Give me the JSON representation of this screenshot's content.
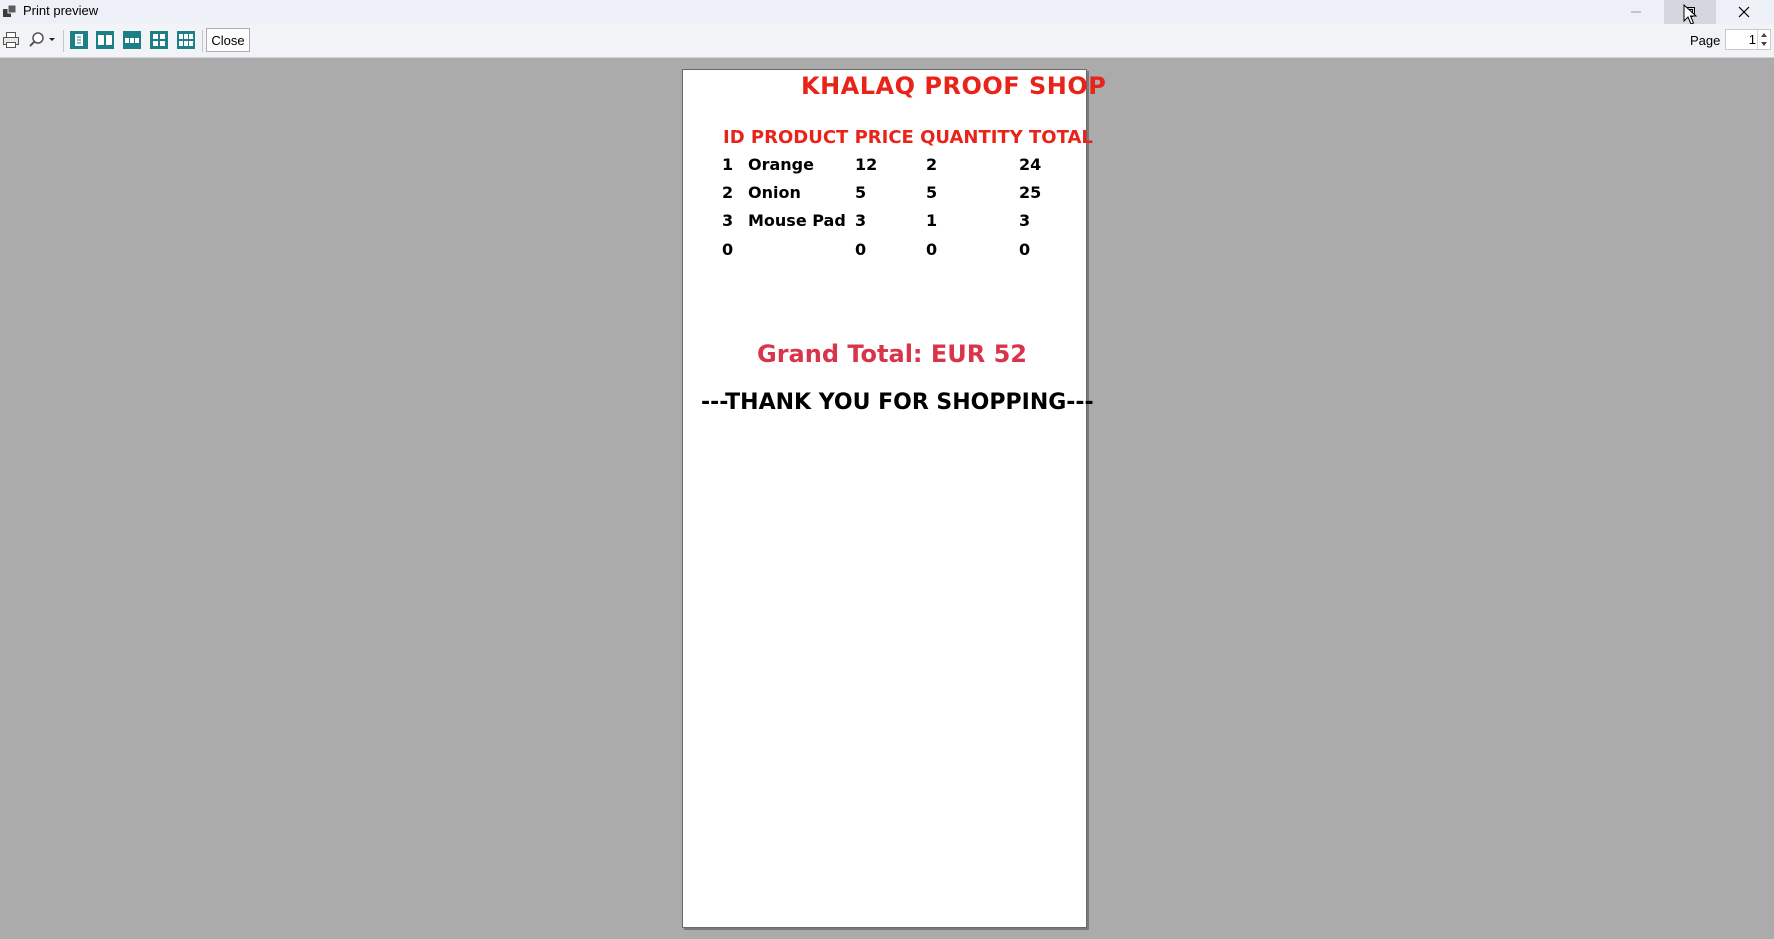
{
  "window": {
    "title": "Print preview",
    "controls": {
      "minimize": "minimize",
      "maximize": "maximize",
      "close": "close"
    }
  },
  "toolbar": {
    "buttons": [
      "print-icon",
      "zoom-icon",
      "one-page-icon",
      "two-pages-icon",
      "three-pages-icon",
      "four-pages-icon",
      "six-pages-icon"
    ],
    "close_label": "Close",
    "page_label": "Page",
    "page_value": "1"
  },
  "receipt": {
    "shop_name": "KHALAQ PROOF SHOP",
    "header": "ID PRODUCT PRICE QUANTITY TOTAL",
    "rows": [
      {
        "id": "1",
        "product": "Orange",
        "price": "12",
        "quantity": "2",
        "total": "24"
      },
      {
        "id": "2",
        "product": "Onion",
        "price": "5",
        "quantity": "5",
        "total": "25"
      },
      {
        "id": "3",
        "product": "Mouse Pad",
        "price": "3",
        "quantity": "1",
        "total": "3"
      },
      {
        "id": "0",
        "product": "",
        "price": "0",
        "quantity": "0",
        "total": "0"
      }
    ],
    "grand_total": "Grand Total: EUR 52",
    "thanks": "---THANK YOU FOR SHOPPING---"
  },
  "colors": {
    "shop_red": "#e8241a",
    "grand_total_red": "#d8344a",
    "workspace_gray": "#ababab",
    "toolbar_teal": "#1f7f86"
  }
}
